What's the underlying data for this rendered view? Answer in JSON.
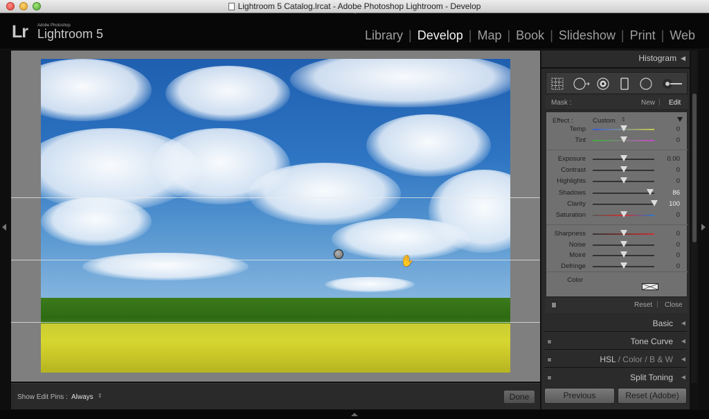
{
  "window": {
    "title": "Lightroom 5 Catalog.lrcat - Adobe Photoshop Lightroom - Develop"
  },
  "logo": {
    "mark": "Lr",
    "vendor": "Adobe Photoshop",
    "product": "Lightroom 5"
  },
  "modules": [
    "Library",
    "Develop",
    "Map",
    "Book",
    "Slideshow",
    "Print",
    "Web"
  ],
  "active_module": "Develop",
  "toolbar": {
    "pins_label": "Show Edit Pins :",
    "pins_value": "Always",
    "done_label": "Done"
  },
  "right_panel": {
    "histogram_label": "Histogram",
    "mask": {
      "label": "Mask :",
      "new": "New",
      "edit": "Edit"
    },
    "effect": {
      "label": "Effect :",
      "preset": "Custom"
    },
    "sliders": [
      {
        "label": "Temp",
        "value": "0",
        "pos": 0.5,
        "color": "temp"
      },
      {
        "label": "Tint",
        "value": "0",
        "pos": 0.5,
        "color": "tint"
      },
      {
        "label": "Exposure",
        "value": "0.00",
        "pos": 0.5,
        "color": "gray"
      },
      {
        "label": "Contrast",
        "value": "0",
        "pos": 0.5,
        "color": "gray"
      },
      {
        "label": "Highlights",
        "value": "0",
        "pos": 0.5,
        "color": "gray"
      },
      {
        "label": "Shadows",
        "value": "86",
        "pos": 0.93,
        "color": "gray"
      },
      {
        "label": "Clarity",
        "value": "100",
        "pos": 1.0,
        "color": "gray"
      },
      {
        "label": "Saturation",
        "value": "0",
        "pos": 0.5,
        "color": "sat"
      },
      {
        "label": "Sharpness",
        "value": "0",
        "pos": 0.5,
        "color": "sharp"
      },
      {
        "label": "Noise",
        "value": "0",
        "pos": 0.5,
        "color": "gray"
      },
      {
        "label": "Moiré",
        "value": "0",
        "pos": 0.5,
        "color": "gray"
      },
      {
        "label": "Defringe",
        "value": "0",
        "pos": 0.5,
        "color": "gray"
      }
    ],
    "color_label": "Color",
    "footer": {
      "reset": "Reset",
      "close": "Close"
    },
    "sections": {
      "basic": "Basic",
      "tone_curve": "Tone Curve",
      "hsl": "HSL",
      "hsl_color": "Color",
      "hsl_bw": "B & W",
      "split_toning": "Split Toning"
    },
    "previous_label": "Previous",
    "reset_adobe_label": "Reset (Adobe)"
  }
}
